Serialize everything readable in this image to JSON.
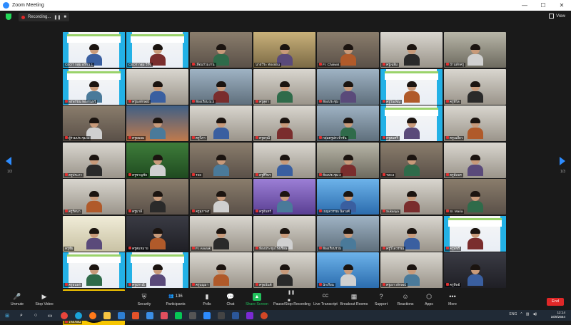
{
  "window": {
    "title": "Zoom Meeting",
    "minimize": "—",
    "maximize": "☐",
    "close": "✕"
  },
  "recording": {
    "label": "Recording...",
    "pause": "❚❚",
    "stop": "■"
  },
  "view": {
    "label": "View"
  },
  "pager": {
    "left": "1/3",
    "right": "1/3"
  },
  "colors": {
    "accent": "#2d8cff",
    "share_green": "#21c05b",
    "end_red": "#e02828",
    "active_speaker": "#f5e33a"
  },
  "tiles": [
    {
      "name": "CEOT กลุ่ม อรพิน 1",
      "bg": "slide",
      "mute": false
    },
    {
      "name": "CEOT กลุ่ม วิรัช",
      "bg": "slide",
      "mute": false
    },
    {
      "name": "เพื่อนร่วมงาน",
      "bg": "room",
      "mute": true
    },
    {
      "name": "นายวีระ ทองอ่อน",
      "bg": "speaker",
      "mute": false,
      "active": true
    },
    {
      "name": "Fr. Chaiwat",
      "bg": "room",
      "mute": true
    },
    {
      "name": "ครูเฉลิม",
      "bg": "face",
      "mute": true
    },
    {
      "name": "บ้านพักครู",
      "bg": "desks",
      "mute": true
    },
    {
      "name": "พรพรรณ ทองจันทร์",
      "bg": "slide",
      "mute": true
    },
    {
      "name": "ครูนงลักษณ์",
      "bg": "face",
      "mute": true
    },
    {
      "name": "ห้องเรียน ม.3",
      "bg": "class",
      "mute": true
    },
    {
      "name": "ครูสุดา",
      "bg": "face",
      "mute": true
    },
    {
      "name": "ห้องประชุม",
      "bg": "class",
      "mute": true
    },
    {
      "name": "ครูวันเพ็ญ",
      "bg": "slide",
      "mute": true
    },
    {
      "name": "ครูพิไล",
      "bg": "face",
      "mute": true
    },
    {
      "name": "ผู้ร่วมประชุม 1",
      "bg": "room",
      "mute": true
    },
    {
      "name": "ครูพยอม",
      "bg": "sunset",
      "mute": true
    },
    {
      "name": "ครูวิภา",
      "bg": "face",
      "mute": true
    },
    {
      "name": "ครูอรุณี",
      "bg": "face",
      "mute": true
    },
    {
      "name": "กลุ่มครูประจำชั้น",
      "bg": "class",
      "mute": true
    },
    {
      "name": "ครูสมศรี",
      "bg": "slide",
      "mute": true
    },
    {
      "name": "ครูเฉลียว",
      "bg": "face",
      "mute": true
    },
    {
      "name": "ครูประภา",
      "bg": "face",
      "mute": true
    },
    {
      "name": "ครูชาญชัย",
      "bg": "green",
      "mute": true
    },
    {
      "name": "T28",
      "bg": "room",
      "mute": true
    },
    {
      "name": "ครูศิริพร",
      "bg": "face",
      "mute": true
    },
    {
      "name": "ห้องประชุม 2",
      "bg": "desks",
      "mute": true
    },
    {
      "name": "T2C4",
      "bg": "room",
      "mute": true
    },
    {
      "name": "ครูอัมพร",
      "bg": "face",
      "mute": true
    },
    {
      "name": "ครูรัตนา",
      "bg": "face",
      "mute": true
    },
    {
      "name": "ครูมาลี",
      "bg": "room",
      "mute": true
    },
    {
      "name": "ครูสุภาพร",
      "bg": "room",
      "mute": true
    },
    {
      "name": "ครูจันทร์",
      "bg": "purple",
      "mute": true
    },
    {
      "name": "เบญจวรรณ นิลวงศ์",
      "bg": "blue",
      "mute": true
    },
    {
      "name": "Sukanya",
      "bg": "face",
      "mute": true
    },
    {
      "name": "Sr. Maria",
      "bg": "room",
      "mute": true
    },
    {
      "name": "ครูชัย",
      "bg": "garden",
      "mute": false
    },
    {
      "name": "ครูสมหมาย",
      "bg": "dark",
      "mute": true
    },
    {
      "name": "Fr. Anurak",
      "bg": "face",
      "mute": true
    },
    {
      "name": "ห้องประชุมโรงเรียน",
      "bg": "face",
      "mute": true
    },
    {
      "name": "ห้องเรียนรวม",
      "bg": "class",
      "mute": true
    },
    {
      "name": "ครูวิไลวรรณ",
      "bg": "face",
      "mute": true
    },
    {
      "name": "ครูพัชรี",
      "bg": "slide",
      "mute": true
    },
    {
      "name": "ครูธนพร",
      "bg": "slide",
      "mute": true
    },
    {
      "name": "ครูปราณี",
      "bg": "slide",
      "mute": true
    },
    {
      "name": "ครูบุญมา",
      "bg": "face",
      "mute": true
    },
    {
      "name": "ครูอนันต์",
      "bg": "face",
      "mute": true
    },
    {
      "name": "นักเรียน",
      "bg": "blue",
      "mute": true
    },
    {
      "name": "ครูเยาวลักษณ์",
      "bg": "face",
      "mute": true
    },
    {
      "name": "ครูทิพย์",
      "bg": "dark",
      "mute": true
    },
    {
      "name": "โรงเรียน",
      "bg": "logo",
      "mute": true
    }
  ],
  "toolbar": {
    "unmute": "Unmute",
    "stop_video": "Stop Video",
    "security": "Security",
    "participants": "Participants",
    "participants_count": "136",
    "polls": "Polls",
    "chat": "Chat",
    "share_screen": "Share Screen",
    "pause_stop_recording": "Pause/Stop Recording",
    "live_transcript": "Live Transcript",
    "breakout_rooms": "Breakout Rooms",
    "support": "Support",
    "reactions": "Reactions",
    "apps": "Apps",
    "more": "More",
    "end": "End"
  },
  "taskbar": {
    "time": "12:14",
    "date": "16/8/2564",
    "language": "ENG"
  }
}
